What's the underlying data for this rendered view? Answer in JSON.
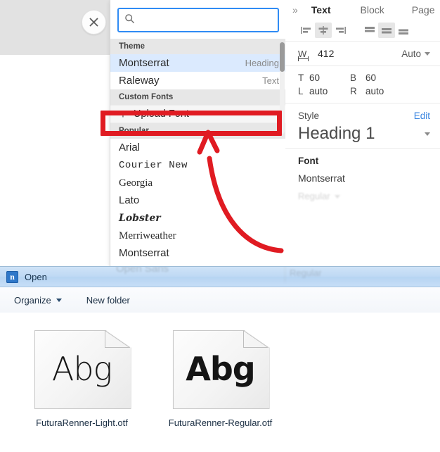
{
  "editor": {
    "close_icon": "close-icon",
    "font_picker": {
      "search": {
        "value": "",
        "placeholder": "",
        "icon": "search-icon"
      },
      "groups": [
        {
          "header": "Theme",
          "fonts": [
            {
              "name": "Montserrat",
              "tag": "Heading",
              "selected": true,
              "style": "f-mont"
            },
            {
              "name": "Raleway",
              "tag": "Text",
              "selected": false,
              "style": "f-ralew"
            }
          ]
        },
        {
          "header": "Custom Fonts",
          "upload": {
            "label": "Upload Font",
            "plus": "+"
          },
          "fonts": []
        },
        {
          "header": "Popular",
          "fonts": [
            {
              "name": "Arial",
              "tag": "",
              "selected": false,
              "style": "f-arial"
            },
            {
              "name": "Courier New",
              "tag": "",
              "selected": false,
              "style": "f-courier"
            },
            {
              "name": "Georgia",
              "tag": "",
              "selected": false,
              "style": "f-georgia"
            },
            {
              "name": "Lato",
              "tag": "",
              "selected": false,
              "style": "f-lato"
            },
            {
              "name": "Lobster",
              "tag": "",
              "selected": false,
              "style": "f-lobster"
            },
            {
              "name": "Merriweather",
              "tag": "",
              "selected": false,
              "style": "f-merri"
            },
            {
              "name": "Montserrat",
              "tag": "",
              "selected": false,
              "style": "f-mont"
            },
            {
              "name": "Open Sans",
              "tag": "",
              "selected": false,
              "style": "f-arial"
            }
          ]
        }
      ]
    },
    "properties_panel": {
      "collapse_icon": "chevron-double-right-icon",
      "tabs": [
        {
          "label": "Text",
          "active": true
        },
        {
          "label": "Block",
          "active": false
        },
        {
          "label": "Page",
          "active": false
        }
      ],
      "align_buttons": [
        {
          "name": "align-left",
          "active": false
        },
        {
          "name": "align-center",
          "active": true
        },
        {
          "name": "align-right",
          "active": false
        },
        {
          "name": "valign-top",
          "active": false
        },
        {
          "name": "valign-middle",
          "active": true
        },
        {
          "name": "valign-bottom",
          "active": false
        }
      ],
      "width": {
        "key": "W",
        "value": "412",
        "mode": "Auto"
      },
      "spacing": {
        "top_key": "T",
        "top_value": "60",
        "bottom_key": "B",
        "bottom_value": "60",
        "left_key": "L",
        "left_value": "auto",
        "right_key": "R",
        "right_value": "auto"
      },
      "style": {
        "label": "Style",
        "edit": "Edit",
        "value": "Heading 1"
      },
      "font": {
        "label": "Font",
        "value": "Montserrat",
        "weight": "Regular"
      }
    }
  },
  "annotation": {
    "highlight_color": "#e01b22",
    "arrow_color": "#e01b22",
    "target": "Upload Font"
  },
  "open_dialog": {
    "title": "Open",
    "app_icon": "notepad-icon",
    "toolbar": [
      {
        "label": "Organize",
        "has_caret": true
      },
      {
        "label": "New folder",
        "has_caret": false
      }
    ],
    "files": [
      {
        "name": "FuturaRenner-Light.otf",
        "preview": "Abg",
        "weight_class": "abg-light"
      },
      {
        "name": "FuturaRenner-Regular.otf",
        "preview": "Abg",
        "weight_class": "abg-reg"
      }
    ]
  }
}
